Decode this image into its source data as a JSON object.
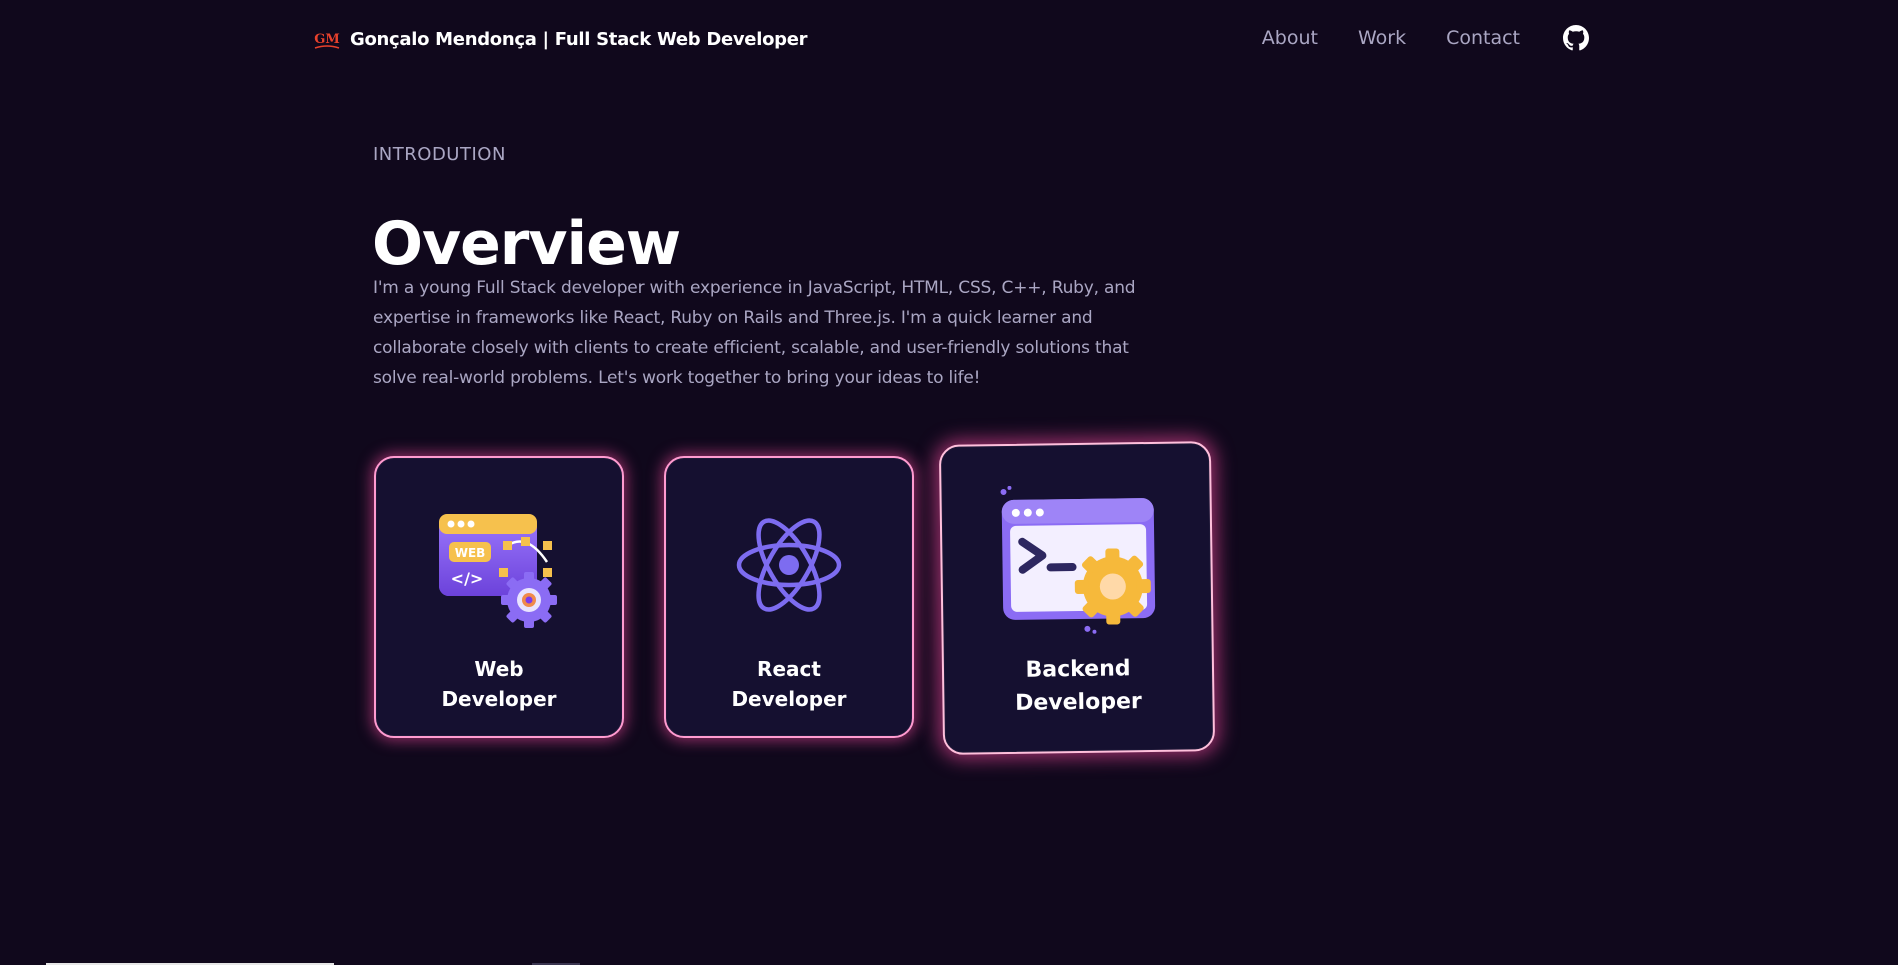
{
  "nav": {
    "logo_text": "GM",
    "brand": "Gonçalo Mendonça  | Full Stack Web Developer",
    "links": [
      "About",
      "Work",
      "Contact"
    ]
  },
  "overview": {
    "subtitle": "INTRODUTION",
    "title": "Overview",
    "paragraph": "I'm a young Full Stack developer with experience in JavaScript, HTML, CSS, C++, Ruby, and expertise in frameworks like React, Ruby on Rails and Three.js. I'm a quick learner and collaborate closely with clients to create efficient, scalable, and user-friendly solutions that solve real-world problems. Let's work together to bring your ideas to life!"
  },
  "services": [
    {
      "line1": "Web",
      "line2": "Developer",
      "icon": "web-dev-icon"
    },
    {
      "line1": "React",
      "line2": "Developer",
      "icon": "react-atom-icon"
    },
    {
      "line1": "Backend",
      "line2": "Developer",
      "icon": "terminal-gear-icon"
    }
  ],
  "colors": {
    "background": "#10081c",
    "card": "#151030",
    "secondary_text": "#aaa6c3",
    "glow": "#ec4899",
    "accent_purple": "#915eff",
    "accent_yellow": "#f6b93b"
  }
}
